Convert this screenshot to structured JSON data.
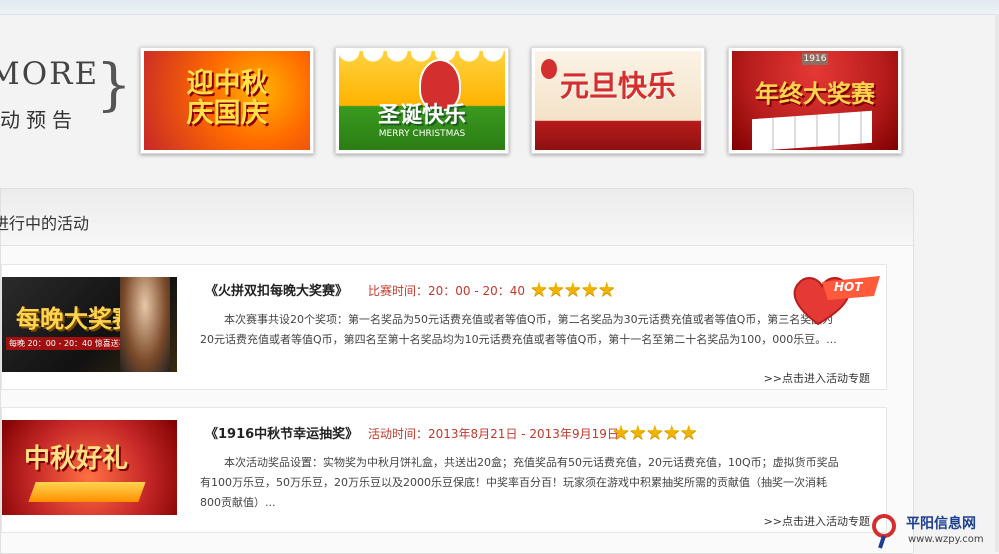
{
  "header": {
    "more_label": "MORE",
    "preview_label": "动预告",
    "brace": "}"
  },
  "thumbnails": [
    {
      "text": "迎中秋\n庆国庆",
      "icon": "mid-autumn-banner"
    },
    {
      "text": "圣诞快乐",
      "subtext": "MERRY CHRISTMAS",
      "icon": "christmas-banner"
    },
    {
      "text": "元旦快乐",
      "icon": "new-year-banner"
    },
    {
      "text": "年终大奖赛",
      "badge": "1916",
      "icon": "year-end-banner"
    }
  ],
  "section": {
    "title": "进行中的活动"
  },
  "activities": [
    {
      "title": "《火拼双扣每晚大奖赛》",
      "time_label": "比赛时间：20：00 - 20：40",
      "stars": "★★★★★",
      "desc": "本次赛事共设20个奖项：第一名奖品为50元话费充值或者等值Q币，第二名奖品为30元话费充值或者等值Q币，第三名奖品为20元话费充值或者等值Q币，第四名至第十名奖品均为10元话费充值或者等值Q币，第十一名至第二十名奖品为100，000乐豆。...",
      "enter_link": ">>点击进入活动专题",
      "banner_text": "每晚大奖赛",
      "banner_sub": "每晚 20：00 - 20：40  惊喜送不停"
    },
    {
      "title": "《1916中秋节幸运抽奖》",
      "time_label": "活动时间：2013年8月21日 - 2013年9月19日",
      "stars": "★★★★★",
      "desc": "本次活动奖品设置：实物奖为中秋月饼礼盒，共送出20盒；充值奖品有50元话费充值，20元话费充值，10Q币；虚拟货币奖品有100万乐豆，50万乐豆，20万乐豆以及2000乐豆保底！中奖率百分百！玩家须在游戏中积累抽奖所需的贡献值（抽奖一次消耗800贡献值）...",
      "enter_link": ">>点击进入活动专题",
      "banner_text": "中秋好礼"
    }
  ],
  "hot_badge": "HOT",
  "footer_logo": {
    "name": "平阳信息网",
    "url": "www.wzpy.com"
  },
  "colors": {
    "accent_red": "#c0392b",
    "star_gold": "#f0b400",
    "logo_blue": "#1c3f8f"
  }
}
